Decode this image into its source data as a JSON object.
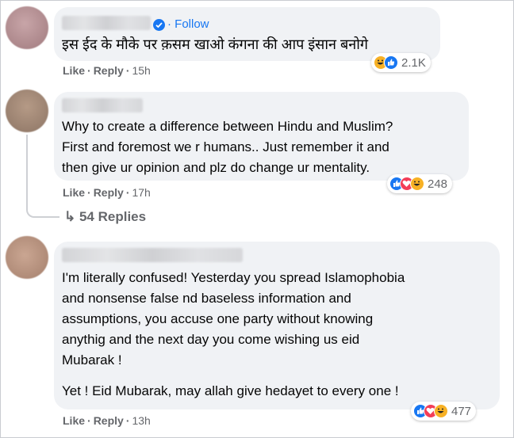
{
  "comments": [
    {
      "text_lines": [
        "इस ईद के मौके पर क़सम खाओ कंगना की आप इंसान बनोगे"
      ],
      "follow_label": "Follow",
      "like_label": "Like",
      "reply_label": "Reply",
      "time": "15h",
      "reaction_icons": [
        "haha-icon",
        "like-icon"
      ],
      "reaction_count": "2.1K"
    },
    {
      "text_lines": [
        "Why to create a difference between Hindu and Muslim?",
        "First and foremost we r humans.. Just remember it and",
        "then give ur opinion and plz do change ur mentality."
      ],
      "like_label": "Like",
      "reply_label": "Reply",
      "time": "17h",
      "reaction_icons": [
        "like-icon",
        "love-icon",
        "haha-icon"
      ],
      "reaction_count": "248",
      "replies_label": "54 Replies"
    },
    {
      "text_lines": [
        "I'm literally confused! Yesterday you spread Islamophobia",
        "and nonsense false nd baseless information and",
        "assumptions, you accuse one party without knowing",
        "anythig and the next day you come wishing us eid",
        "Mubarak !",
        "Yet ! Eid Mubarak, may allah give hedayet to every one !"
      ],
      "like_label": "Like",
      "reply_label": "Reply",
      "time": "13h",
      "reaction_icons": [
        "like-icon",
        "love-icon",
        "haha-icon"
      ],
      "reaction_count": "477"
    }
  ],
  "colors": {
    "bubble": "#f0f2f5",
    "meta_text": "#65676b",
    "accent_blue": "#1877f2",
    "love_red": "#f33e58",
    "haha_yellow": "#f7b125"
  }
}
